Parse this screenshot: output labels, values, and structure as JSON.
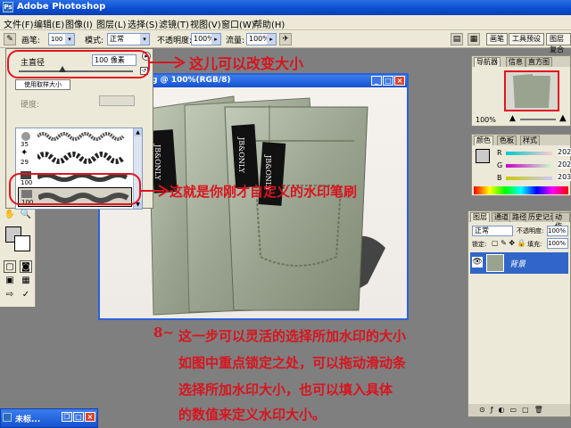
{
  "window": {
    "title": "Adobe Photoshop"
  },
  "menu": [
    "文件(F)",
    "编辑(E)",
    "图像(I)",
    "图层(L)",
    "选择(S)",
    "滤镜(T)",
    "视图(V)",
    "窗口(W)",
    "帮助(H)"
  ],
  "options_bar": {
    "brush_label": "画笔:",
    "brush_size": "100",
    "mode_label": "模式:",
    "mode_value": "正常",
    "opacity_label": "不透明度:",
    "opacity_value": "100%",
    "flow_label": "流量:",
    "flow_value": "100%",
    "wells": [
      "画笔",
      "工具预设",
      "图层复合"
    ]
  },
  "brush_picker": {
    "master_diameter_label": "主直径",
    "master_diameter_value": "100 像素",
    "use_sample_size": "使用取样大小",
    "hardness_label": "硬度:",
    "slider_fraction": 0.38,
    "brush_sizes": [
      "35",
      "29",
      "100",
      "100"
    ]
  },
  "document": {
    "title": "g @ 100%(RGB/8)"
  },
  "navigator": {
    "tabs": [
      "导航器",
      "信息",
      "直方图"
    ],
    "zoom": "100%"
  },
  "color_panel": {
    "tabs": [
      "颜色",
      "色板",
      "样式"
    ],
    "channels": [
      {
        "label": "R",
        "value": "202"
      },
      {
        "label": "G",
        "value": "202"
      },
      {
        "label": "B",
        "value": "203"
      }
    ]
  },
  "layers_panel": {
    "tabs": [
      "图层",
      "通道",
      "路径",
      "历史记录",
      "动作"
    ],
    "blend_mode": "正常",
    "opacity_label": "不透明度:",
    "opacity_value": "100%",
    "lock_label": "锁定:",
    "fill_label": "填充:",
    "fill_value": "100%",
    "layer_name": "背景"
  },
  "annotations": {
    "note1": "这儿可以改变大小",
    "note2": "这就是你刚才自定义的水印笔刷",
    "step_number": "8~",
    "step_lines": [
      "这一步可以灵活的选择所加水印的大小",
      "如图中重点锁定之处，可以拖动滑动条",
      "选择所加水印大小，也可以填入具体",
      "的数值来定义水印大小。"
    ]
  },
  "photo": {
    "tag_text": "JB&ONLY"
  },
  "taskbar": {
    "label": "未标..."
  },
  "colors": {
    "annotation_red": "#d8141e",
    "title_blue": "#0a4cd0",
    "chrome": "#ece9d8"
  }
}
